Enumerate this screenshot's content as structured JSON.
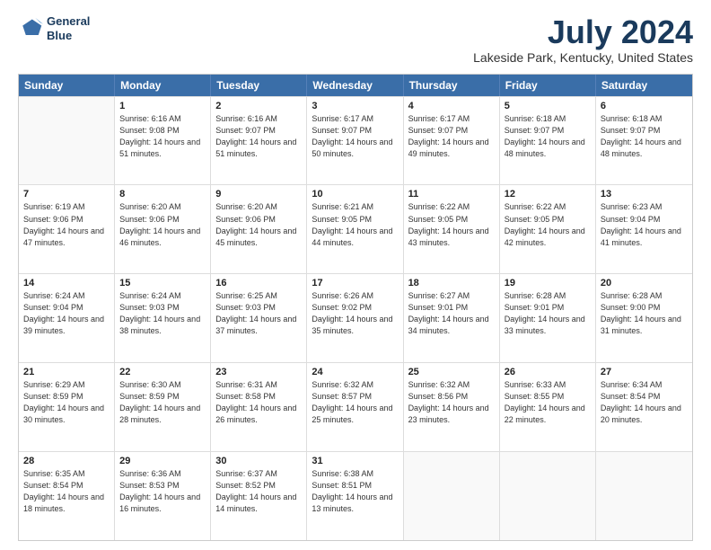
{
  "logo": {
    "line1": "General",
    "line2": "Blue"
  },
  "title": "July 2024",
  "subtitle": "Lakeside Park, Kentucky, United States",
  "header_days": [
    "Sunday",
    "Monday",
    "Tuesday",
    "Wednesday",
    "Thursday",
    "Friday",
    "Saturday"
  ],
  "weeks": [
    [
      {
        "day": "",
        "sunrise": "",
        "sunset": "",
        "daylight": ""
      },
      {
        "day": "1",
        "sunrise": "Sunrise: 6:16 AM",
        "sunset": "Sunset: 9:08 PM",
        "daylight": "Daylight: 14 hours and 51 minutes."
      },
      {
        "day": "2",
        "sunrise": "Sunrise: 6:16 AM",
        "sunset": "Sunset: 9:07 PM",
        "daylight": "Daylight: 14 hours and 51 minutes."
      },
      {
        "day": "3",
        "sunrise": "Sunrise: 6:17 AM",
        "sunset": "Sunset: 9:07 PM",
        "daylight": "Daylight: 14 hours and 50 minutes."
      },
      {
        "day": "4",
        "sunrise": "Sunrise: 6:17 AM",
        "sunset": "Sunset: 9:07 PM",
        "daylight": "Daylight: 14 hours and 49 minutes."
      },
      {
        "day": "5",
        "sunrise": "Sunrise: 6:18 AM",
        "sunset": "Sunset: 9:07 PM",
        "daylight": "Daylight: 14 hours and 48 minutes."
      },
      {
        "day": "6",
        "sunrise": "Sunrise: 6:18 AM",
        "sunset": "Sunset: 9:07 PM",
        "daylight": "Daylight: 14 hours and 48 minutes."
      }
    ],
    [
      {
        "day": "7",
        "sunrise": "Sunrise: 6:19 AM",
        "sunset": "Sunset: 9:06 PM",
        "daylight": "Daylight: 14 hours and 47 minutes."
      },
      {
        "day": "8",
        "sunrise": "Sunrise: 6:20 AM",
        "sunset": "Sunset: 9:06 PM",
        "daylight": "Daylight: 14 hours and 46 minutes."
      },
      {
        "day": "9",
        "sunrise": "Sunrise: 6:20 AM",
        "sunset": "Sunset: 9:06 PM",
        "daylight": "Daylight: 14 hours and 45 minutes."
      },
      {
        "day": "10",
        "sunrise": "Sunrise: 6:21 AM",
        "sunset": "Sunset: 9:05 PM",
        "daylight": "Daylight: 14 hours and 44 minutes."
      },
      {
        "day": "11",
        "sunrise": "Sunrise: 6:22 AM",
        "sunset": "Sunset: 9:05 PM",
        "daylight": "Daylight: 14 hours and 43 minutes."
      },
      {
        "day": "12",
        "sunrise": "Sunrise: 6:22 AM",
        "sunset": "Sunset: 9:05 PM",
        "daylight": "Daylight: 14 hours and 42 minutes."
      },
      {
        "day": "13",
        "sunrise": "Sunrise: 6:23 AM",
        "sunset": "Sunset: 9:04 PM",
        "daylight": "Daylight: 14 hours and 41 minutes."
      }
    ],
    [
      {
        "day": "14",
        "sunrise": "Sunrise: 6:24 AM",
        "sunset": "Sunset: 9:04 PM",
        "daylight": "Daylight: 14 hours and 39 minutes."
      },
      {
        "day": "15",
        "sunrise": "Sunrise: 6:24 AM",
        "sunset": "Sunset: 9:03 PM",
        "daylight": "Daylight: 14 hours and 38 minutes."
      },
      {
        "day": "16",
        "sunrise": "Sunrise: 6:25 AM",
        "sunset": "Sunset: 9:03 PM",
        "daylight": "Daylight: 14 hours and 37 minutes."
      },
      {
        "day": "17",
        "sunrise": "Sunrise: 6:26 AM",
        "sunset": "Sunset: 9:02 PM",
        "daylight": "Daylight: 14 hours and 35 minutes."
      },
      {
        "day": "18",
        "sunrise": "Sunrise: 6:27 AM",
        "sunset": "Sunset: 9:01 PM",
        "daylight": "Daylight: 14 hours and 34 minutes."
      },
      {
        "day": "19",
        "sunrise": "Sunrise: 6:28 AM",
        "sunset": "Sunset: 9:01 PM",
        "daylight": "Daylight: 14 hours and 33 minutes."
      },
      {
        "day": "20",
        "sunrise": "Sunrise: 6:28 AM",
        "sunset": "Sunset: 9:00 PM",
        "daylight": "Daylight: 14 hours and 31 minutes."
      }
    ],
    [
      {
        "day": "21",
        "sunrise": "Sunrise: 6:29 AM",
        "sunset": "Sunset: 8:59 PM",
        "daylight": "Daylight: 14 hours and 30 minutes."
      },
      {
        "day": "22",
        "sunrise": "Sunrise: 6:30 AM",
        "sunset": "Sunset: 8:59 PM",
        "daylight": "Daylight: 14 hours and 28 minutes."
      },
      {
        "day": "23",
        "sunrise": "Sunrise: 6:31 AM",
        "sunset": "Sunset: 8:58 PM",
        "daylight": "Daylight: 14 hours and 26 minutes."
      },
      {
        "day": "24",
        "sunrise": "Sunrise: 6:32 AM",
        "sunset": "Sunset: 8:57 PM",
        "daylight": "Daylight: 14 hours and 25 minutes."
      },
      {
        "day": "25",
        "sunrise": "Sunrise: 6:32 AM",
        "sunset": "Sunset: 8:56 PM",
        "daylight": "Daylight: 14 hours and 23 minutes."
      },
      {
        "day": "26",
        "sunrise": "Sunrise: 6:33 AM",
        "sunset": "Sunset: 8:55 PM",
        "daylight": "Daylight: 14 hours and 22 minutes."
      },
      {
        "day": "27",
        "sunrise": "Sunrise: 6:34 AM",
        "sunset": "Sunset: 8:54 PM",
        "daylight": "Daylight: 14 hours and 20 minutes."
      }
    ],
    [
      {
        "day": "28",
        "sunrise": "Sunrise: 6:35 AM",
        "sunset": "Sunset: 8:54 PM",
        "daylight": "Daylight: 14 hours and 18 minutes."
      },
      {
        "day": "29",
        "sunrise": "Sunrise: 6:36 AM",
        "sunset": "Sunset: 8:53 PM",
        "daylight": "Daylight: 14 hours and 16 minutes."
      },
      {
        "day": "30",
        "sunrise": "Sunrise: 6:37 AM",
        "sunset": "Sunset: 8:52 PM",
        "daylight": "Daylight: 14 hours and 14 minutes."
      },
      {
        "day": "31",
        "sunrise": "Sunrise: 6:38 AM",
        "sunset": "Sunset: 8:51 PM",
        "daylight": "Daylight: 14 hours and 13 minutes."
      },
      {
        "day": "",
        "sunrise": "",
        "sunset": "",
        "daylight": ""
      },
      {
        "day": "",
        "sunrise": "",
        "sunset": "",
        "daylight": ""
      },
      {
        "day": "",
        "sunrise": "",
        "sunset": "",
        "daylight": ""
      }
    ]
  ]
}
